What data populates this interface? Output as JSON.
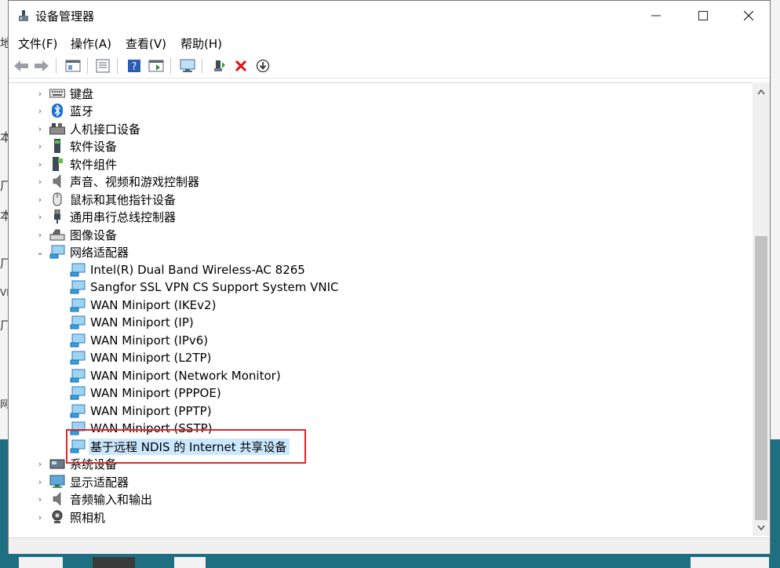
{
  "window": {
    "title": "设备管理器"
  },
  "menubar": {
    "file": "文件(F)",
    "action": "操作(A)",
    "view": "查看(V)",
    "help": "帮助(H)"
  },
  "tree": {
    "categories_top": [
      {
        "label": "键盘",
        "icon": "keyboard-icon"
      },
      {
        "label": "蓝牙",
        "icon": "bluetooth-icon"
      },
      {
        "label": "人机接口设备",
        "icon": "hid-icon"
      },
      {
        "label": "软件设备",
        "icon": "software-device-icon"
      },
      {
        "label": "软件组件",
        "icon": "software-component-icon"
      },
      {
        "label": "声音、视频和游戏控制器",
        "icon": "speaker-icon"
      },
      {
        "label": "鼠标和其他指针设备",
        "icon": "mouse-icon"
      },
      {
        "label": "通用串行总线控制器",
        "icon": "usb-icon"
      },
      {
        "label": "图像设备",
        "icon": "camera-device-icon"
      }
    ],
    "network": {
      "label": "网络适配器",
      "children": [
        "Intel(R) Dual Band Wireless-AC 8265",
        "Sangfor SSL VPN CS Support System VNIC",
        "WAN Miniport (IKEv2)",
        "WAN Miniport (IP)",
        "WAN Miniport (IPv6)",
        "WAN Miniport (L2TP)",
        "WAN Miniport (Network Monitor)",
        "WAN Miniport (PPPOE)",
        "WAN Miniport (PPTP)",
        "WAN Miniport (SSTP)",
        "基于远程 NDIS 的 Internet 共享设备"
      ]
    },
    "categories_bottom": [
      {
        "label": "系统设备",
        "icon": "system-device-icon"
      },
      {
        "label": "显示适配器",
        "icon": "display-adapter-icon"
      },
      {
        "label": "音频输入和输出",
        "icon": "audio-io-icon"
      },
      {
        "label": "照相机",
        "icon": "webcam-icon"
      }
    ]
  },
  "background_text": [
    "地",
    "本",
    "厂",
    "本",
    "厂",
    "VI",
    "厂",
    "网"
  ]
}
